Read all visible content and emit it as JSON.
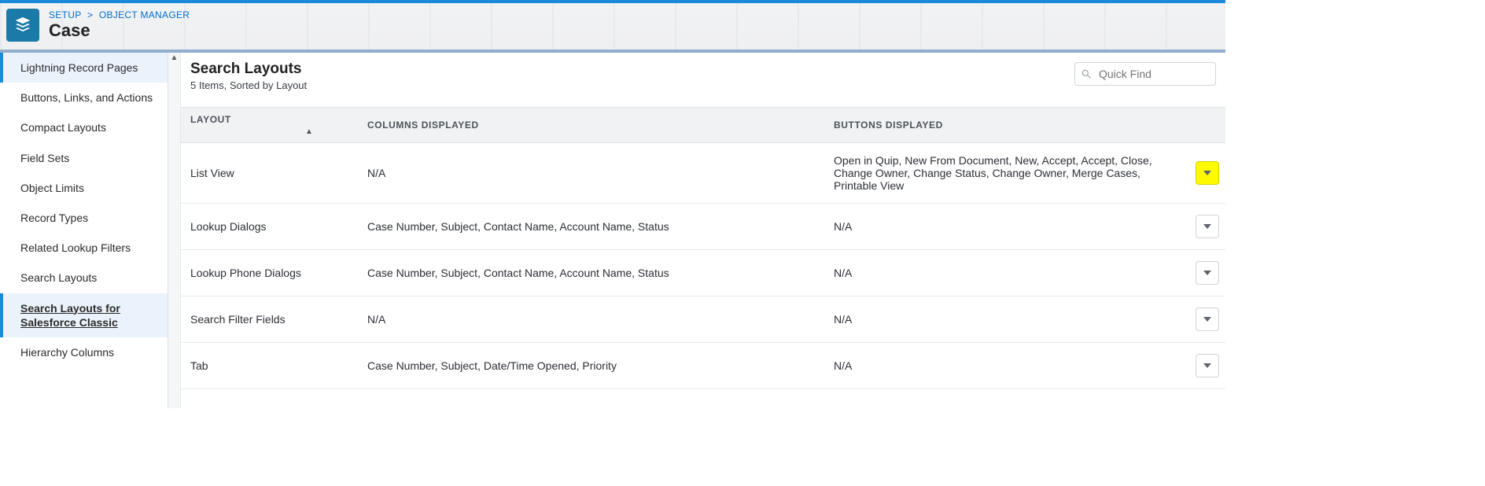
{
  "breadcrumb": {
    "setup": "SETUP",
    "object_manager": "OBJECT MANAGER"
  },
  "object_title": "Case",
  "sidebar": {
    "items": [
      {
        "label": "Lightning Record Pages",
        "accent": true
      },
      {
        "label": "Buttons, Links, and Actions"
      },
      {
        "label": "Compact Layouts"
      },
      {
        "label": "Field Sets"
      },
      {
        "label": "Object Limits"
      },
      {
        "label": "Record Types"
      },
      {
        "label": "Related Lookup Filters"
      },
      {
        "label": "Search Layouts"
      },
      {
        "label": "Search Layouts for Salesforce Classic",
        "accent": true,
        "current": true
      },
      {
        "label": "Hierarchy Columns"
      }
    ]
  },
  "main": {
    "title": "Search Layouts",
    "subtitle": "5 Items, Sorted by Layout",
    "quickfind_placeholder": "Quick Find"
  },
  "table": {
    "headers": {
      "layout": "LAYOUT",
      "columns": "COLUMNS DISPLAYED",
      "buttons": "BUTTONS DISPLAYED"
    },
    "rows": [
      {
        "layout": "List View",
        "columns": "N/A",
        "buttons": "Open in Quip, New From Document, New, Accept, Accept, Close, Change Owner, Change Status, Change Owner, Merge Cases, Printable View",
        "menu_hi": true
      },
      {
        "layout": "Lookup Dialogs",
        "columns": "Case Number, Subject, Contact Name, Account Name, Status",
        "buttons": "N/A"
      },
      {
        "layout": "Lookup Phone Dialogs",
        "columns": "Case Number, Subject, Contact Name, Account Name, Status",
        "buttons": "N/A"
      },
      {
        "layout": "Search Filter Fields",
        "columns": "N/A",
        "buttons": "N/A"
      },
      {
        "layout": "Tab",
        "columns": "Case Number, Subject, Date/Time Opened, Priority",
        "buttons": "N/A"
      }
    ]
  }
}
